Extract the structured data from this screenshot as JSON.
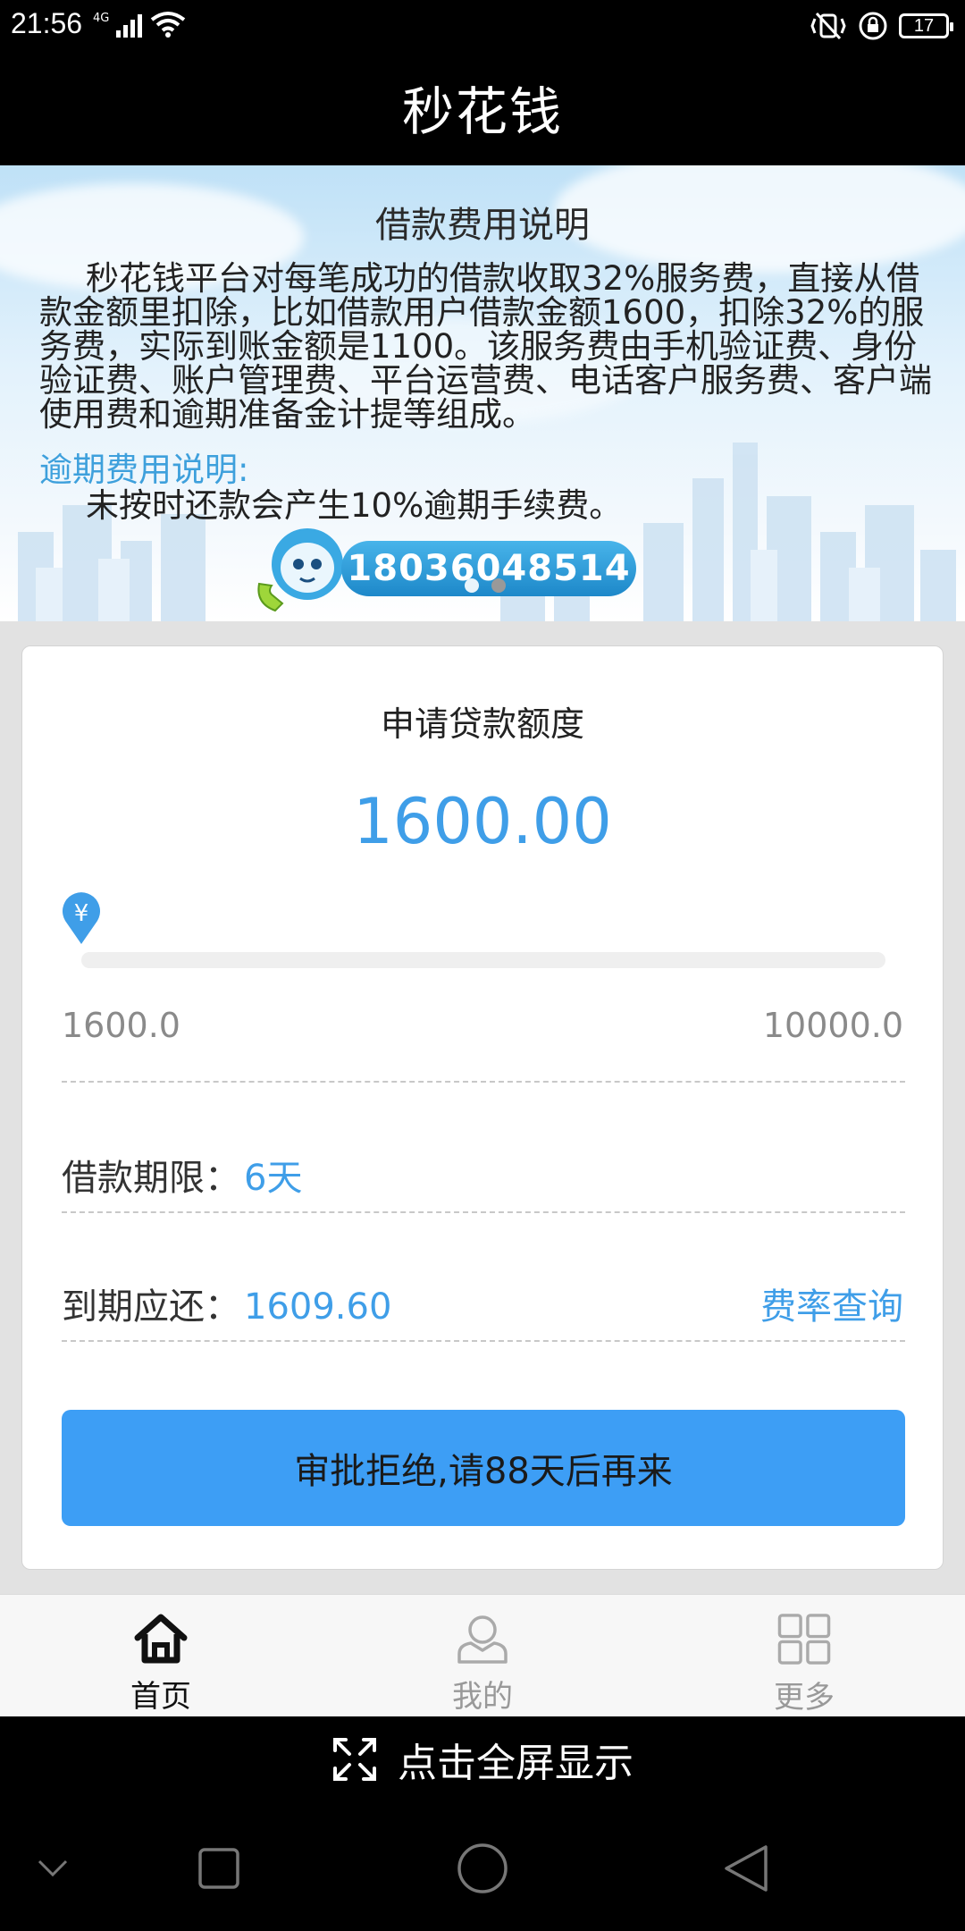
{
  "status_bar": {
    "time": "21:56",
    "network": "4G",
    "battery": "17"
  },
  "header": {
    "title": "秒花钱"
  },
  "banner": {
    "title": "借款费用说明",
    "body": "秒花钱平台对每笔成功的借款收取32%服务费，直接从借款金额里扣除，比如借款用户借款金额1600，扣除32%的服务费，实际到账金额是1100。该服务费由手机验证费、身份验证费、账户管理费、平台运营费、电话客户服务费、客户端使用费和逾期准备金计提等组成。",
    "overdue_title": "逾期费用说明:",
    "overdue_body": "未按时还款会产生10%逾期手续费。",
    "phone": "18036048514",
    "carousel_dots": 2,
    "active_dot": 1
  },
  "loan_card": {
    "title": "申请贷款额度",
    "amount": "1600.00",
    "slider_value_fraction": 0,
    "slider_icon": "¥",
    "range_min": "1600.0",
    "range_max": "10000.0",
    "term_label": "借款期限：",
    "term_value": "6天",
    "due_label": "到期应还：",
    "due_value": "1609.60",
    "rate_link": "费率查询",
    "action_button": "审批拒绝,请88天后再来"
  },
  "tabbar": {
    "tabs": [
      {
        "label": "首页",
        "icon": "home-icon",
        "active": true
      },
      {
        "label": "我的",
        "icon": "user-icon",
        "active": false
      },
      {
        "label": "更多",
        "icon": "grid-icon",
        "active": false
      }
    ]
  },
  "fullscreen": {
    "label": "点击全屏显示",
    "icon": "expand-icon"
  },
  "colors": {
    "accent": "#3f9ee8",
    "button": "#3d9ef5",
    "link": "#3ea0dc"
  }
}
